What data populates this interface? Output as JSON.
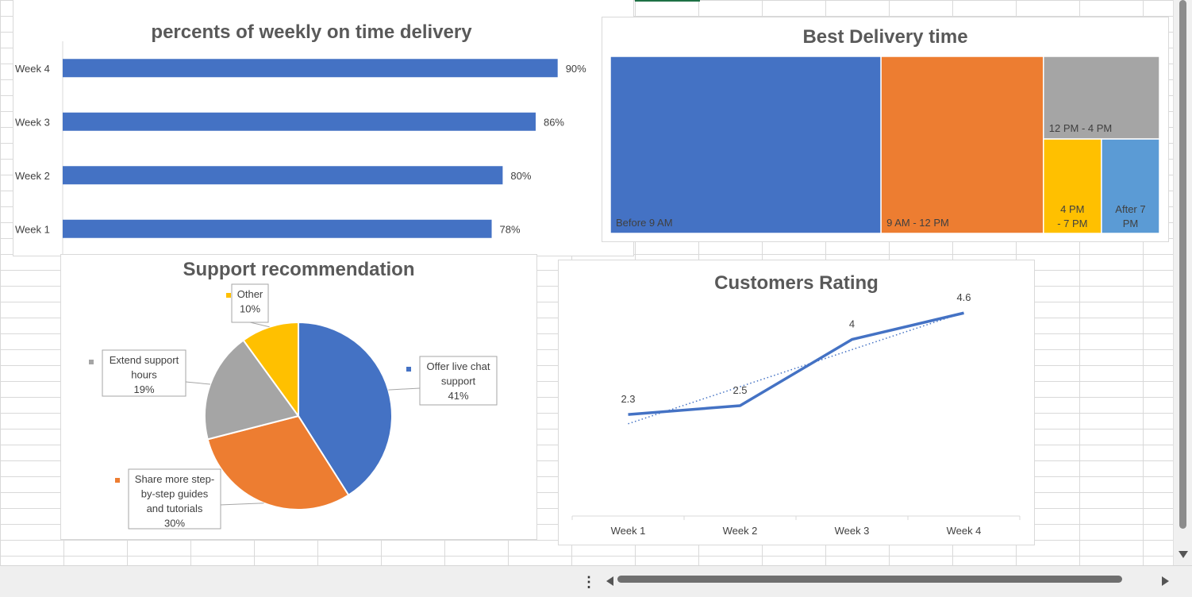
{
  "app": {
    "name": "Spreadsheet workbook"
  },
  "colors": {
    "blue": "#4472C4",
    "orange": "#ED7D31",
    "gray": "#A5A5A5",
    "gold": "#FFC000",
    "lightblue": "#5B9BD5",
    "title": "#595959",
    "label": "#404040",
    "gridline": "#d9d9d9"
  },
  "chart_data": [
    {
      "type": "bar",
      "orientation": "horizontal",
      "title": "percents of  weekly on time delivery",
      "categories": [
        "Week 1",
        "Week 2",
        "Week 3",
        "Week 4"
      ],
      "values": [
        78,
        80,
        86,
        90
      ],
      "value_labels": [
        "78%",
        "80%",
        "86%",
        "90%"
      ],
      "xlabel": "",
      "ylabel": "",
      "xlim": [
        0,
        100
      ],
      "grid": false,
      "legend": "none"
    },
    {
      "type": "treemap",
      "title": "Best Delivery time",
      "categories": [
        "Before 9 AM",
        "9 AM - 12 PM",
        "12 PM - 4 PM",
        "4 PM - 7 PM",
        "After 7 PM"
      ],
      "values": [
        35,
        21,
        7,
        4,
        4
      ],
      "legend": "none"
    },
    {
      "type": "pie",
      "title": "Support recommendation",
      "categories": [
        "Offer live chat support",
        "Share more step-by-step guides and tutorials",
        "Extend support hours",
        "Other"
      ],
      "values": [
        41,
        30,
        19,
        10
      ],
      "value_labels": [
        "41%",
        "30%",
        "19%",
        "10%"
      ],
      "legend": "data callouts"
    },
    {
      "type": "line",
      "title": "Customers Rating",
      "categories": [
        "Week 1",
        "Week 2",
        "Week 3",
        "Week 4"
      ],
      "values": [
        2.3,
        2.5,
        4,
        4.6
      ],
      "value_labels": [
        "2.3",
        "2.5",
        "4",
        "4.6"
      ],
      "trendline": "linear",
      "ylim": [
        0,
        5
      ],
      "grid": false,
      "legend": "none"
    }
  ]
}
